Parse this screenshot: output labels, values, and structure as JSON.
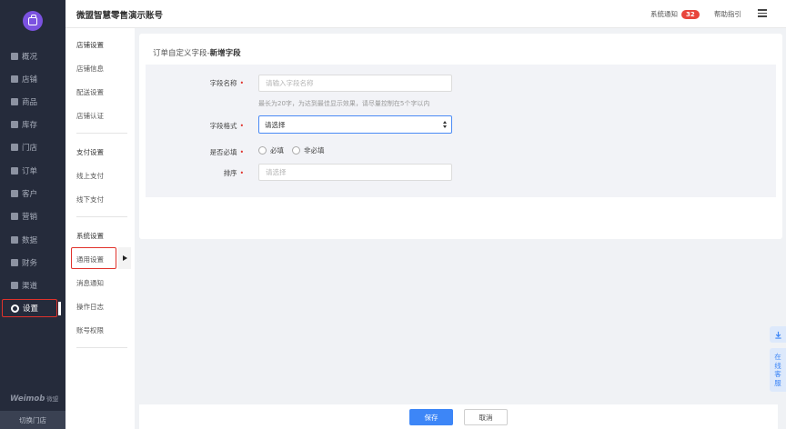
{
  "app": {
    "title": "微盟智慧零售演示账号",
    "notice_label": "系统通知",
    "notice_count": "32",
    "help_label": "帮助指引",
    "brand": "Weimob",
    "brand_cn": "微盟",
    "switch_store": "切换门店",
    "accent_color": "#3d86f7",
    "highlight_color": "#e0322b"
  },
  "sidebar": {
    "items": [
      {
        "label": "概况",
        "icon": "overview-icon"
      },
      {
        "label": "店铺",
        "icon": "store-icon"
      },
      {
        "label": "商品",
        "icon": "goods-icon"
      },
      {
        "label": "库存",
        "icon": "inventory-icon"
      },
      {
        "label": "门店",
        "icon": "shop-icon"
      },
      {
        "label": "订单",
        "icon": "order-icon"
      },
      {
        "label": "客户",
        "icon": "customer-icon"
      },
      {
        "label": "营销",
        "icon": "marketing-icon"
      },
      {
        "label": "数据",
        "icon": "data-icon"
      },
      {
        "label": "财务",
        "icon": "finance-icon"
      },
      {
        "label": "渠道",
        "icon": "channel-icon"
      },
      {
        "label": "设置",
        "icon": "settings-icon"
      }
    ]
  },
  "subnav": {
    "groups": [
      {
        "title": "店铺设置",
        "items": [
          "店铺信息",
          "配送设置",
          "店铺认证"
        ]
      },
      {
        "title": "支付设置",
        "items": [
          "线上支付",
          "线下支付"
        ]
      },
      {
        "title": "系统设置",
        "items": [
          "通用设置",
          "消息通知",
          "操作日志",
          "账号权限"
        ]
      }
    ]
  },
  "main": {
    "breadcrumb_prefix": "订单自定义字段-",
    "breadcrumb_current": "新增字段",
    "form": {
      "name_label": "字段名称",
      "name_placeholder": "请输入字段名称",
      "name_hint": "最长为20字，为达到最佳显示效果，请尽量控制在5个字以内",
      "format_label": "字段格式",
      "format_value": "请选择",
      "required_label": "是否必填",
      "required_options": [
        "必填",
        "非必填"
      ],
      "order_label": "排序",
      "order_placeholder": "请选择",
      "required_mark": "•"
    }
  },
  "footer": {
    "save_label": "保存",
    "cancel_label": "取消"
  },
  "float": {
    "download_icon": "download-icon",
    "service_label": [
      "在",
      "线",
      "客",
      "服"
    ]
  }
}
